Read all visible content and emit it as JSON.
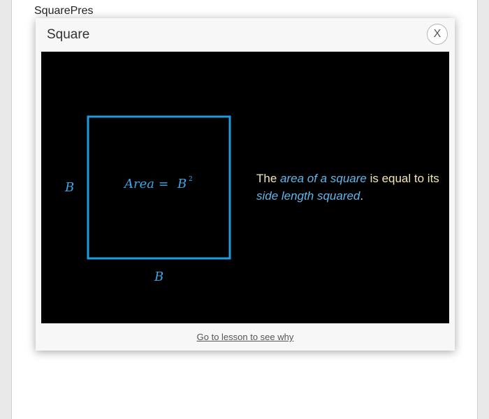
{
  "background": {
    "title": "SquarePres",
    "lines": [
      "ı",
      "ı",
      "ı"
    ]
  },
  "modal": {
    "title": "Square",
    "close_label": "X",
    "lesson_link": "Go to lesson to see why"
  },
  "diagram": {
    "side_label_left": "B",
    "side_label_bottom": "B",
    "formula_left": "Area",
    "formula_eq": "=",
    "formula_base": "B",
    "formula_exp": "2",
    "square_color": "#1f9be0"
  },
  "explanation": {
    "part1": "The ",
    "em1": "area of a square",
    "part2": " is equal to its ",
    "em2": "side length squared",
    "part3": "."
  }
}
